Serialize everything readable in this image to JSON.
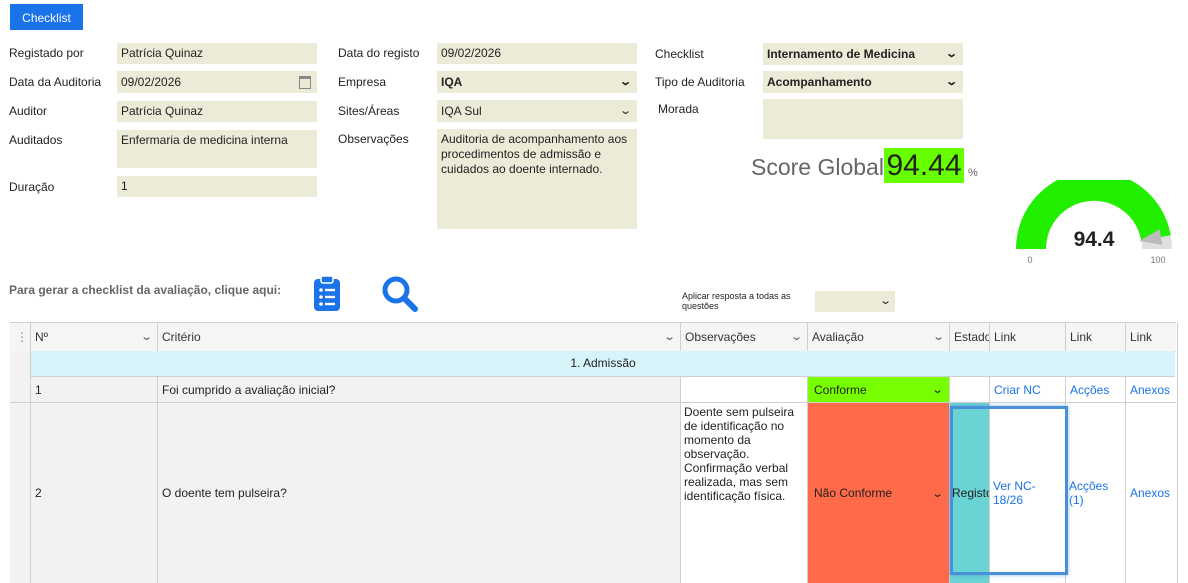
{
  "header": {
    "checklist_button": "Checklist"
  },
  "form": {
    "registado_por": {
      "label": "Registado por",
      "value": "Patrícia Quinaz"
    },
    "data_auditoria": {
      "label": "Data da Auditoria",
      "value": "09/02/2026"
    },
    "auditor": {
      "label": "Auditor",
      "value": "Patrícia Quinaz"
    },
    "auditados": {
      "label": "Auditados",
      "value": "Enfermaria de medicina interna"
    },
    "duracao": {
      "label": "Duração",
      "value": "1"
    },
    "data_registo": {
      "label": "Data do registo",
      "value": "09/02/2026"
    },
    "empresa": {
      "label": "Empresa",
      "value": "IQA"
    },
    "sites": {
      "label": "Sites/Áreas",
      "value": "IQA Sul"
    },
    "observacoes": {
      "label": "Observações",
      "value": "Auditoria de acompanhamento aos procedimentos de admissão e cuidados ao doente internado."
    },
    "checklist": {
      "label": "Checklist",
      "value": "Internamento de Medicina"
    },
    "tipo_auditoria": {
      "label": "Tipo de Auditoria",
      "value": "Acompanhamento"
    },
    "morada": {
      "label": "Morada",
      "value": ""
    }
  },
  "score": {
    "label": "Score Global",
    "value": "94.44",
    "unit": "%",
    "gauge_value": "94.4",
    "gauge_fraction": 0.944,
    "gauge_min": "0",
    "gauge_max": "100",
    "gauge_color": "#22ee00"
  },
  "actions": {
    "generate_text": "Para gerar a checklist da avaliação, clique aqui:",
    "checklist_icon": "clipboard-list-icon",
    "search_icon": "search-icon",
    "apply_all_text": "Aplicar resposta a todas as questões",
    "apply_all_value": ""
  },
  "table": {
    "columns": [
      "Nº",
      "Critério",
      "Observações",
      "Avaliação",
      "Estado",
      "Link",
      "Link",
      "Link"
    ],
    "group": "1. Admissão",
    "rows": [
      {
        "num": "1",
        "criterio": "Foi cumprido a avaliação inicial?",
        "observacoes": "",
        "avaliacao": "Conforme",
        "estado": "",
        "link1": "Criar NC",
        "link2": "Acções",
        "link3": "Anexos"
      },
      {
        "num": "2",
        "criterio": "O doente tem pulseira?",
        "observacoes": "Doente sem pulseira de identificação no momento da observação. Confirmação verbal realizada, mas sem identificação física.",
        "avaliacao": "Não Conforme",
        "estado": "Registo",
        "link1": "Ver NC-18/26",
        "link2": "Acções (1)",
        "link3": "Anexos"
      }
    ]
  },
  "colors": {
    "primary": "#1a73e8",
    "field_bg": "#ecebd7",
    "conforme": "#77ff00",
    "nao_conforme": "#ff6a48",
    "estado": "#6ad3d4",
    "group_bg": "#d7f4fb"
  }
}
